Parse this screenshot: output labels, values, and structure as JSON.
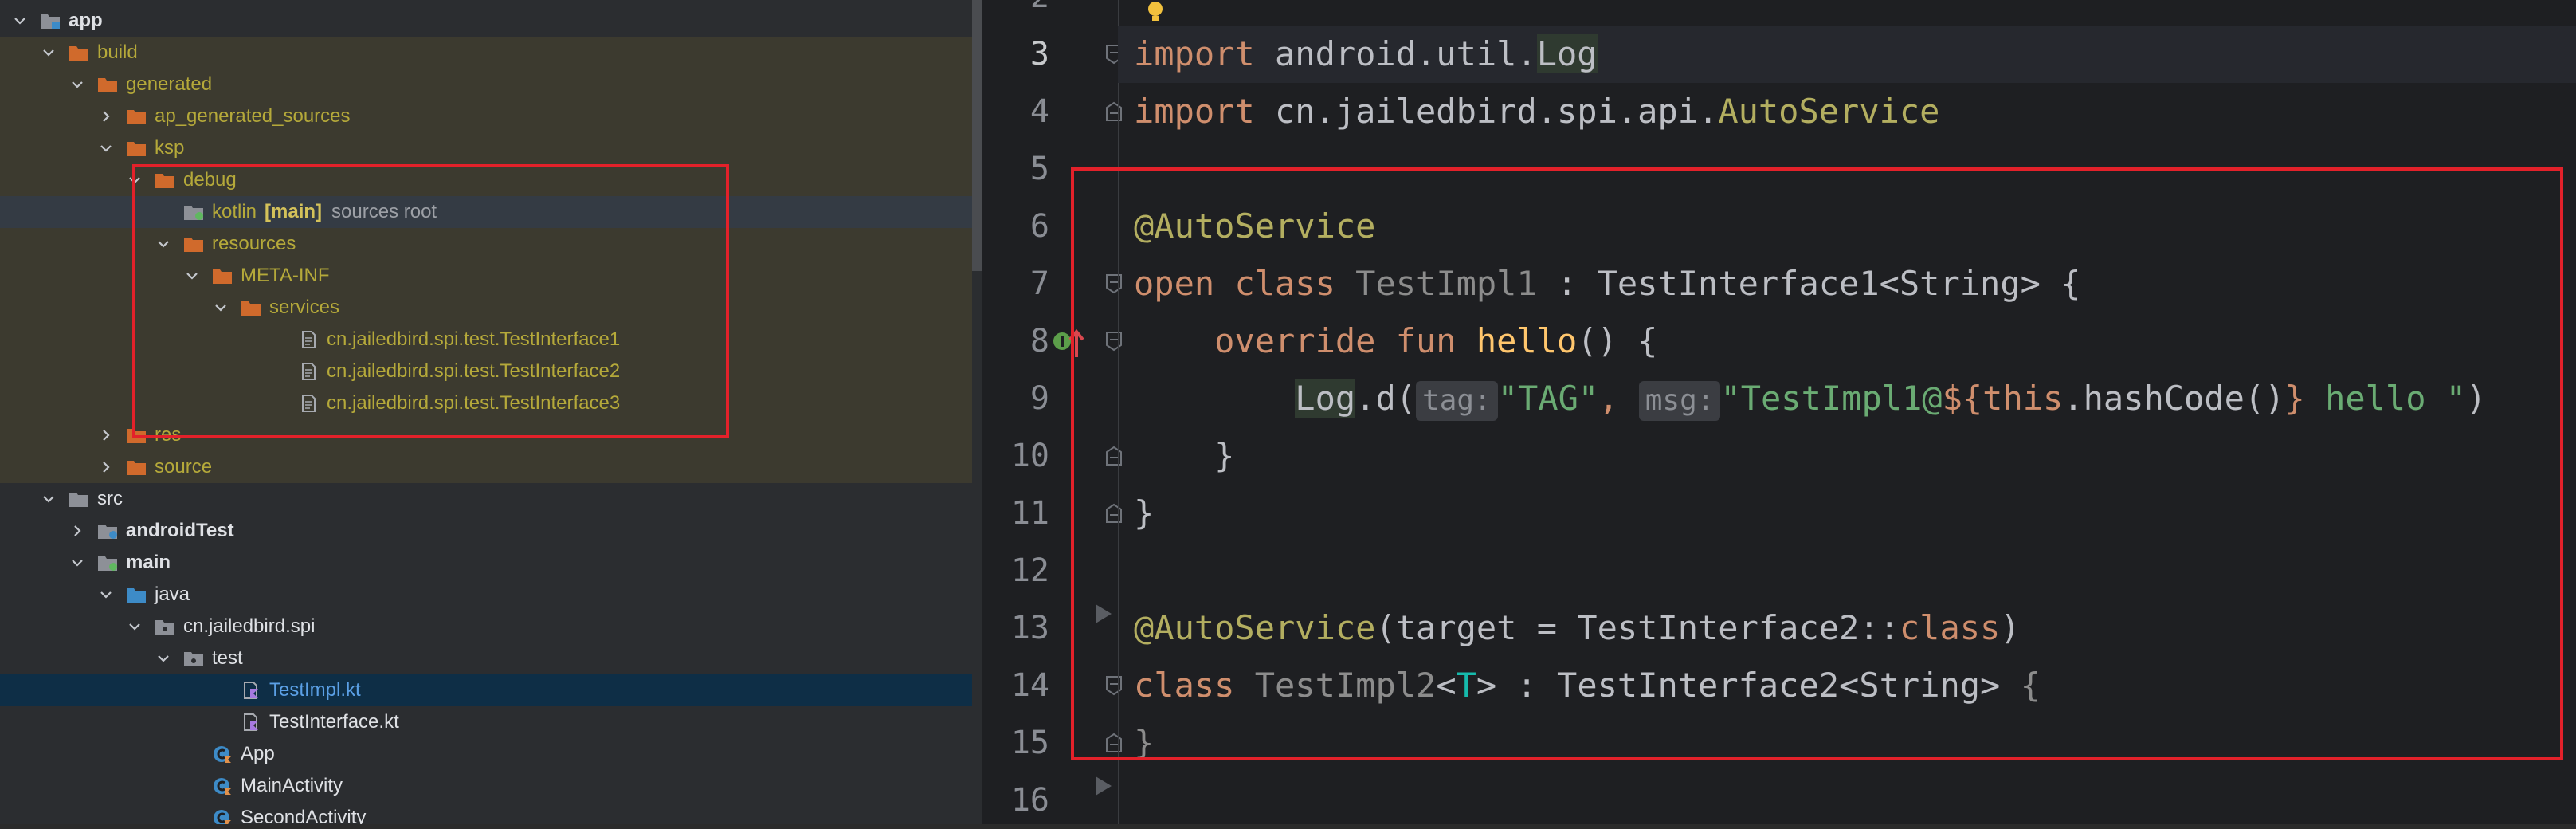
{
  "project_tree": {
    "rows": [
      {
        "label": "app",
        "depth": 0,
        "expanded": true,
        "icon": "module-folder-icon",
        "style": "bold"
      },
      {
        "label": "build",
        "depth": 1,
        "expanded": true,
        "icon": "orange-folder-icon",
        "style": "olive"
      },
      {
        "label": "generated",
        "depth": 2,
        "expanded": true,
        "icon": "orange-folder-icon",
        "style": "olive"
      },
      {
        "label": "ap_generated_sources",
        "depth": 3,
        "expanded": false,
        "icon": "orange-folder-icon",
        "style": "olive"
      },
      {
        "label": "ksp",
        "depth": 3,
        "expanded": true,
        "icon": "orange-folder-icon",
        "style": "olive"
      },
      {
        "label": "debug",
        "depth": 4,
        "expanded": true,
        "icon": "orange-folder-icon",
        "style": "olive"
      },
      {
        "label": "kotlin",
        "depth": 5,
        "expanded": null,
        "icon": "source-root-folder-icon",
        "style": "olive",
        "tag": "[main]",
        "sub": "sources root",
        "highlight": true
      },
      {
        "label": "resources",
        "depth": 5,
        "expanded": true,
        "icon": "orange-folder-icon",
        "style": "olive"
      },
      {
        "label": "META-INF",
        "depth": 6,
        "expanded": true,
        "icon": "orange-folder-icon",
        "style": "olive"
      },
      {
        "label": "services",
        "depth": 7,
        "expanded": true,
        "icon": "orange-folder-icon",
        "style": "olive"
      },
      {
        "label": "cn.jailedbird.spi.test.TestInterface1",
        "depth": 9,
        "expanded": null,
        "icon": "text-file-icon",
        "style": "olive"
      },
      {
        "label": "cn.jailedbird.spi.test.TestInterface2",
        "depth": 9,
        "expanded": null,
        "icon": "text-file-icon",
        "style": "olive"
      },
      {
        "label": "cn.jailedbird.spi.test.TestInterface3",
        "depth": 9,
        "expanded": null,
        "icon": "text-file-icon",
        "style": "olive"
      },
      {
        "label": "res",
        "depth": 3,
        "expanded": false,
        "icon": "orange-folder-icon",
        "style": "olive"
      },
      {
        "label": "source",
        "depth": 3,
        "expanded": false,
        "icon": "orange-folder-icon",
        "style": "olive"
      },
      {
        "label": "src",
        "depth": 1,
        "expanded": true,
        "icon": "grey-folder-icon",
        "style": "normal"
      },
      {
        "label": "androidTest",
        "depth": 2,
        "expanded": false,
        "icon": "test-folder-icon",
        "style": "bold"
      },
      {
        "label": "main",
        "depth": 2,
        "expanded": true,
        "icon": "source-folder-icon",
        "style": "bold"
      },
      {
        "label": "java",
        "depth": 3,
        "expanded": true,
        "icon": "blue-folder-icon",
        "style": "normal"
      },
      {
        "label": "cn.jailedbird.spi",
        "depth": 4,
        "expanded": true,
        "icon": "package-icon",
        "style": "normal"
      },
      {
        "label": "test",
        "depth": 5,
        "expanded": true,
        "icon": "package-icon",
        "style": "normal"
      },
      {
        "label": "TestImpl.kt",
        "depth": 7,
        "expanded": null,
        "icon": "kotlin-file-icon",
        "style": "blue",
        "selected": true
      },
      {
        "label": "TestInterface.kt",
        "depth": 7,
        "expanded": null,
        "icon": "kotlin-file-icon",
        "style": "normal"
      },
      {
        "label": "App",
        "depth": 6,
        "expanded": null,
        "icon": "kotlin-class-icon",
        "style": "normal"
      },
      {
        "label": "MainActivity",
        "depth": 6,
        "expanded": null,
        "icon": "kotlin-class-icon",
        "style": "normal"
      },
      {
        "label": "SecondActivity",
        "depth": 6,
        "expanded": null,
        "icon": "kotlin-class-icon",
        "style": "normal"
      }
    ]
  },
  "editor": {
    "line_numbers": [
      "2",
      "3",
      "4",
      "5",
      "6",
      "7",
      "8",
      "9",
      "10",
      "11",
      "12",
      "13",
      "14",
      "15",
      "16"
    ],
    "current_line": "3",
    "code": {
      "l3": {
        "kw": "import",
        "pkg": " android.util.",
        "cls": "Log"
      },
      "l4": {
        "kw": "import",
        "pkg": " cn.jailedbird.spi.api.",
        "cls": "AutoService"
      },
      "l6": {
        "ann": "@AutoService"
      },
      "l7": {
        "kw1": "open",
        "kw2": " class ",
        "name": "TestImpl1",
        "rest": " : TestInterface1<String> {"
      },
      "l8": {
        "indent": "    ",
        "kw1": "override",
        "kw2": " fun ",
        "fn": "hello",
        "rest": "() {"
      },
      "l9": {
        "indent": "        ",
        "log": "Log",
        "call": ".d(",
        "hint_tag": "tag:",
        "s1": "\"TAG\"",
        "comma": ", ",
        "hint_msg": "msg:",
        "s2a": "\"TestImpl1@",
        "tmpl_open": "${",
        "this": "this",
        "hash": ".hashCode()",
        "tmpl_close": "}",
        "s2b": " hello \"",
        "close": ")"
      },
      "l10": {
        "text": "    }"
      },
      "l11": {
        "text": "}"
      },
      "l13": {
        "ann": "@AutoService",
        "p1": "(target = TestInterface2::",
        "kw": "class",
        "p2": ")"
      },
      "l14": {
        "kw": "class",
        "sp": " ",
        "name": "TestImpl2",
        "lt": "<",
        "tparam": "T",
        "rest": "> : TestInterface2<String> ",
        "brace": "{"
      },
      "l15": {
        "text": "}"
      }
    }
  },
  "colors": {
    "highlight_box": "#e3212a",
    "keyword": "#cf8e6d",
    "annotation": "#b3ae60",
    "string": "#6aab73",
    "function": "#ffc66d",
    "generated_folder_text": "#b5a93a",
    "selected_row": "#0e2e46"
  }
}
